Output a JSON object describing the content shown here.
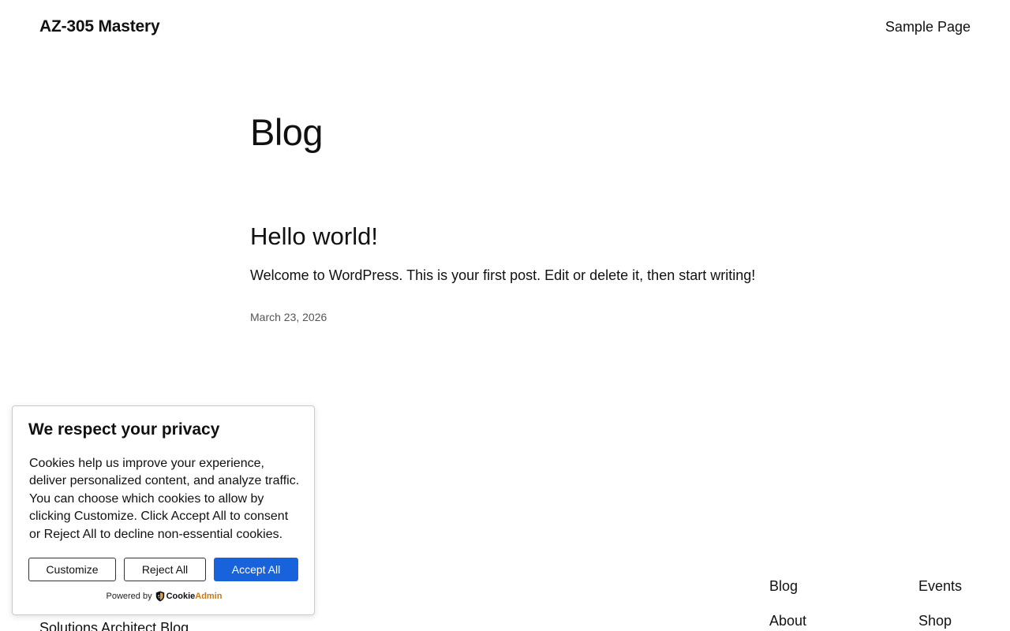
{
  "header": {
    "site_title": "AZ-305 Mastery",
    "nav": [
      {
        "label": "Sample Page"
      }
    ]
  },
  "main": {
    "heading": "Blog",
    "posts": [
      {
        "title": "Hello world!",
        "excerpt": "Welcome to WordPress. This is your first post. Edit or delete it, then start writing!",
        "date": "March 23, 2026"
      }
    ]
  },
  "footer": {
    "site_link": "Solutions Architect Blog",
    "col1": [
      {
        "label": "Blog"
      },
      {
        "label": "About"
      }
    ],
    "col2": [
      {
        "label": "Events"
      },
      {
        "label": "Shop"
      }
    ]
  },
  "cookie_banner": {
    "title": "We respect your privacy",
    "body": "Cookies help us improve your experience, deliver personalized content, and analyze traffic. You can choose which cookies to allow by clicking Customize. Click Accept All to consent or Reject All to decline non-essential cookies.",
    "customize_label": "Customize",
    "reject_label": "Reject All",
    "accept_label": "Accept All",
    "powered_by": "Powered by",
    "brand_part1": "Cookie",
    "brand_part2": "Admin",
    "accent_color": "#1863dc",
    "brand_icon": "cookieadmin-shield-icon"
  }
}
